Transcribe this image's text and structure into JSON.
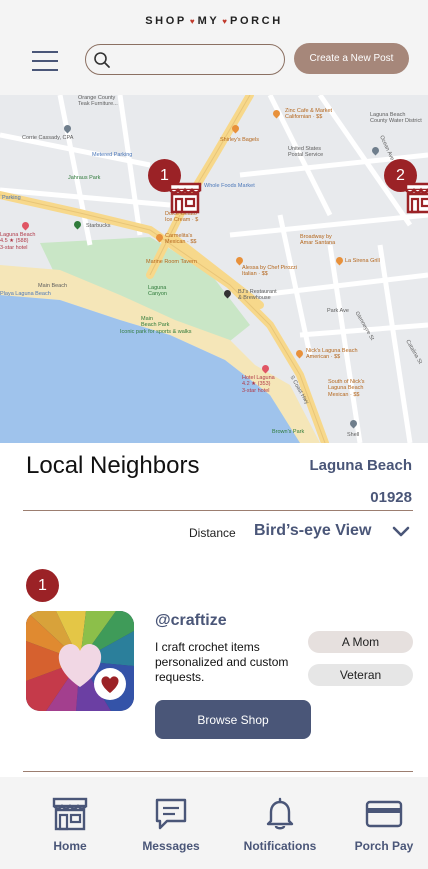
{
  "brand": {
    "left": "SHOP",
    "middle": "MY",
    "right": "PORCH",
    "separator": "♥"
  },
  "header": {
    "search_placeholder": "",
    "new_post_label": "Create a New Post"
  },
  "map": {
    "markers": [
      {
        "label": "1"
      },
      {
        "label": "2"
      }
    ],
    "labels": {
      "orange_county": "Orange County\nTeak Furniture...",
      "corrie": "Corrie Cassady, CPA",
      "metered": "Metered Parking",
      "jahraus": "Jahraus Park",
      "parking": "Parking",
      "laguna_beach_hotel": "Laguna Beach\n4.5 ★ (588)\n3-star hotel",
      "starbucks": "Starbucks",
      "whole_foods": "Whole Foods Market",
      "dolce": "Dolce Gelato\nIce Cream · $",
      "carmelitas": "Carmelita's\nMexican · $$",
      "marine_room": "Marine Room Tavern",
      "main_beach": "Main Beach",
      "laguna_canyon": "Laguna\nCanyon",
      "playa": "Playa Laguna Beach",
      "main_beach_park": "Main\nBeach Park",
      "coastal": "Iconic park for sports & walks",
      "zinc": "Zinc Cafe & Market\nCalifornian · $$",
      "shirleys": "Shirley's Bagels",
      "postal": "United States\nPostal Service",
      "laguna_county": "Laguna Beach\nCounty Water District",
      "broadway": "Broadway by\nAmar Santana",
      "alessa": "Alessa by Chef Pirozzi\nItalian · $$",
      "lj_sirena": "La Sirena Grill",
      "bjs": "BJ's Restaurant\n& Brewhouse",
      "park_ave": "Park Ave",
      "nicks": "Nick's Laguna Beach\nAmerican · $$",
      "hotel_laguna": "Hotel Laguna\n4.2 ★ (353)\n3-star hotel",
      "south_nicks": "South of Nick's\nLaguna Beach\nMexican · $$",
      "browns": "Brown's Park",
      "shell": "Shell",
      "coast_hwy": "S Coast Hwy",
      "glenneyre": "Glenneyre St",
      "catalina": "Catalina St",
      "ocean": "Ocean Ave"
    }
  },
  "section": {
    "title": "Local Neighbors",
    "city": "Laguna Beach",
    "zip": "01928",
    "distance_label": "Distance",
    "distance_value": "Bird’s-eye View"
  },
  "listing": {
    "number": "1",
    "username": "@craftize",
    "bio": "I craft crochet items personalized and custom requests.",
    "tags": [
      "A Mom",
      "Veteran"
    ],
    "browse_label": "Browse Shop"
  },
  "nav": {
    "items": [
      {
        "label": "Home",
        "icon": "storefront-icon"
      },
      {
        "label": "Messages",
        "icon": "message-icon"
      },
      {
        "label": "Notifications",
        "icon": "bell-icon"
      },
      {
        "label": "Porch Pay",
        "icon": "credit-card-icon"
      }
    ]
  },
  "colors": {
    "accent": "#4a5678",
    "brand_red": "#9b2226",
    "button_tan": "#a6877a"
  }
}
